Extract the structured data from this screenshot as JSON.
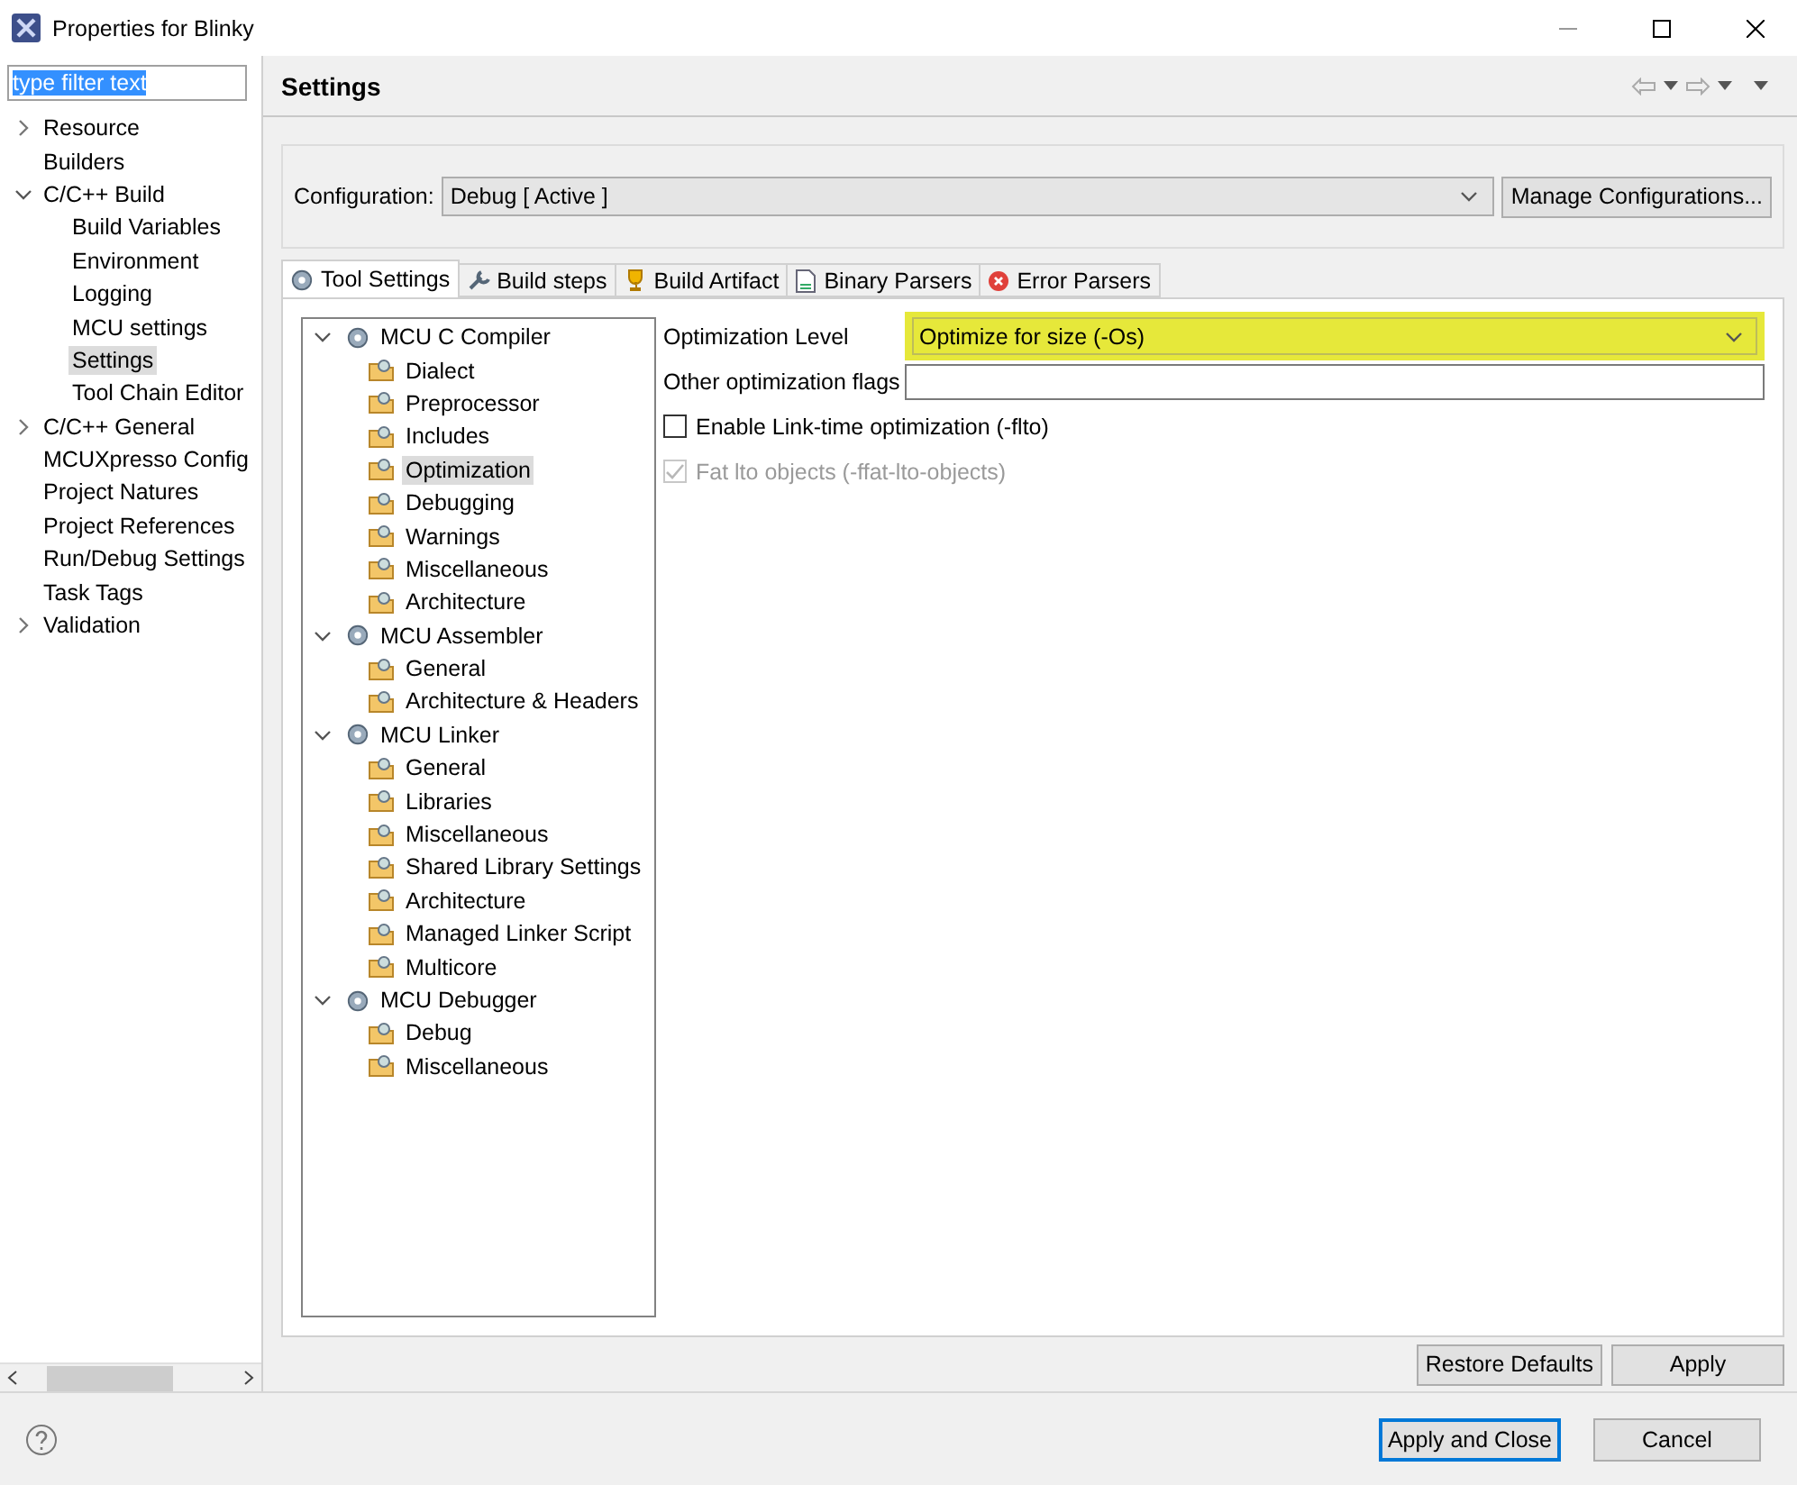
{
  "window": {
    "title": "Properties for Blinky"
  },
  "sidebar": {
    "filter": {
      "value": "type filter text"
    },
    "items": [
      {
        "label": "Resource",
        "expanded": false,
        "selected": false
      },
      {
        "label": "Builders",
        "selected": false
      },
      {
        "label": "C/C++ Build",
        "expanded": true,
        "selected": false,
        "children": [
          {
            "label": "Build Variables",
            "selected": false
          },
          {
            "label": "Environment",
            "selected": false
          },
          {
            "label": "Logging",
            "selected": false
          },
          {
            "label": "MCU settings",
            "selected": false
          },
          {
            "label": "Settings",
            "selected": true
          },
          {
            "label": "Tool Chain Editor",
            "selected": false
          }
        ]
      },
      {
        "label": "C/C++ General",
        "expanded": false,
        "selected": false
      },
      {
        "label": "MCUXpresso Config",
        "selected": false
      },
      {
        "label": "Project Natures",
        "selected": false
      },
      {
        "label": "Project References",
        "selected": false
      },
      {
        "label": "Run/Debug Settings",
        "selected": false
      },
      {
        "label": "Task Tags",
        "selected": false
      },
      {
        "label": "Validation",
        "expanded": false,
        "selected": false
      }
    ]
  },
  "page": {
    "title": "Settings",
    "configuration": {
      "label": "Configuration:",
      "value": "Debug  [ Active ]",
      "button": "Manage Configurations..."
    },
    "tabs": [
      {
        "label": "Tool Settings",
        "selected": true
      },
      {
        "label": "Build steps",
        "selected": false
      },
      {
        "label": "Build Artifact",
        "selected": false
      },
      {
        "label": "Binary Parsers",
        "selected": false
      },
      {
        "label": "Error Parsers",
        "selected": false
      }
    ],
    "tool_tree": [
      {
        "label": "MCU C Compiler",
        "expanded": true,
        "selected": false,
        "children": [
          {
            "label": "Dialect",
            "selected": false
          },
          {
            "label": "Preprocessor",
            "selected": false
          },
          {
            "label": "Includes",
            "selected": false
          },
          {
            "label": "Optimization",
            "selected": true
          },
          {
            "label": "Debugging",
            "selected": false
          },
          {
            "label": "Warnings",
            "selected": false
          },
          {
            "label": "Miscellaneous",
            "selected": false
          },
          {
            "label": "Architecture",
            "selected": false
          }
        ]
      },
      {
        "label": "MCU Assembler",
        "expanded": true,
        "selected": false,
        "children": [
          {
            "label": "General",
            "selected": false
          },
          {
            "label": "Architecture & Headers",
            "selected": false
          }
        ]
      },
      {
        "label": "MCU Linker",
        "expanded": true,
        "selected": false,
        "children": [
          {
            "label": "General",
            "selected": false
          },
          {
            "label": "Libraries",
            "selected": false
          },
          {
            "label": "Miscellaneous",
            "selected": false
          },
          {
            "label": "Shared Library Settings",
            "selected": false
          },
          {
            "label": "Architecture",
            "selected": false
          },
          {
            "label": "Managed Linker Script",
            "selected": false
          },
          {
            "label": "Multicore",
            "selected": false
          }
        ]
      },
      {
        "label": "MCU Debugger",
        "expanded": true,
        "selected": false,
        "children": [
          {
            "label": "Debug",
            "selected": false
          },
          {
            "label": "Miscellaneous",
            "selected": false
          }
        ]
      }
    ],
    "options": [
      {
        "kind": "dropdown",
        "label": "Optimization Level",
        "value": "Optimize for size (-Os)",
        "highlighted": true
      },
      {
        "kind": "text",
        "label": "Other optimization flags"
      },
      {
        "kind": "checkbox",
        "label": "Enable Link-time optimization (-flto)",
        "checked": false,
        "disabled": false
      },
      {
        "kind": "checkbox",
        "label": "Fat lto objects (-ffat-lto-objects)",
        "checked": true,
        "disabled": true
      }
    ],
    "buttons": [
      "Restore Defaults",
      "Apply"
    ]
  },
  "footer": {
    "buttons": [
      {
        "label": "Apply and Close",
        "default": true
      },
      {
        "label": "Cancel",
        "default": false
      }
    ]
  }
}
